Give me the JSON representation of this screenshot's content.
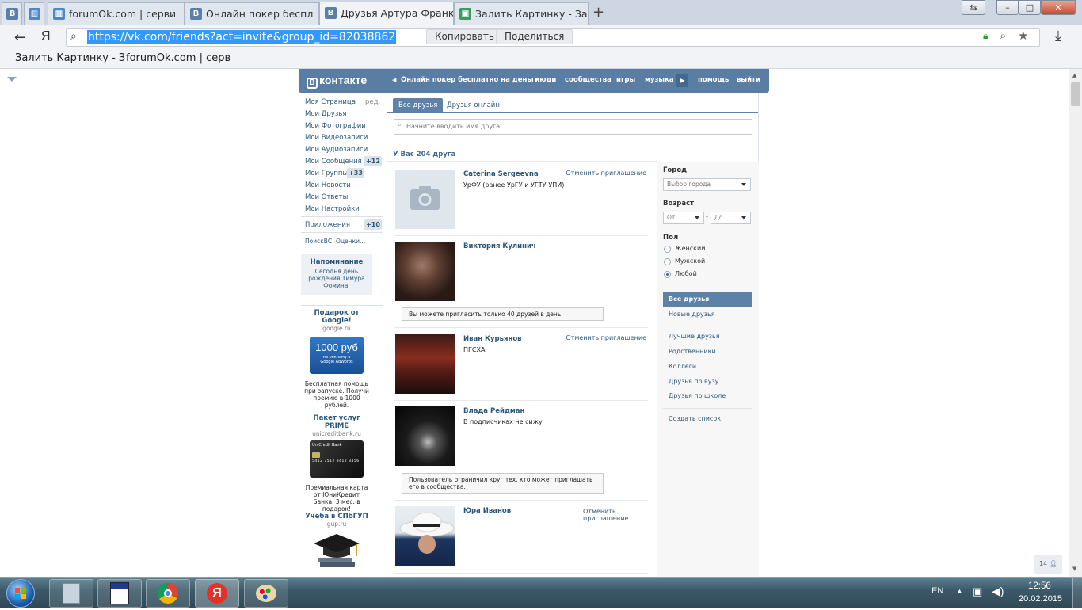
{
  "browser": {
    "tabs": [
      {
        "title": "forumOk.com | серви",
        "icon": "forumok-favicon"
      },
      {
        "title": "Онлайн покер беспл",
        "icon": "vk-favicon"
      },
      {
        "title": "Друзья Артура Франк",
        "icon": "vk-favicon"
      },
      {
        "title": "Залить Картинку - За",
        "icon": "image-favicon"
      }
    ],
    "pinned_icon_1": "В",
    "url": "https://vk.com/friends?act=invite&group_id=82038862",
    "copy_label": "Копировать",
    "share_label": "Поделиться",
    "yandex_letter": "Я",
    "bookmarks": [
      "Залить Картинку - З",
      "forumOk.com | серв"
    ],
    "tab_glyph": "В"
  },
  "vk": {
    "logo": "контакте",
    "logo_letter": "B",
    "nav": {
      "back_title": "Онлайн покер бесплатно на деньги",
      "people": "люди",
      "communities": "сообщества",
      "games": "игры",
      "music": "музыка",
      "help": "помощь",
      "logout": "выйти"
    },
    "left_menu": [
      {
        "label": "Моя Страница",
        "extra": "ред."
      },
      {
        "label": "Мои Друзья"
      },
      {
        "label": "Мои Фотографии"
      },
      {
        "label": "Мои Видеозаписи"
      },
      {
        "label": "Мои Аудиозаписи"
      },
      {
        "label": "Мои Сообщения",
        "count": "+12"
      },
      {
        "label": "Мои Группы",
        "count": "+33"
      },
      {
        "label": "Мои Новости"
      },
      {
        "label": "Мои Ответы"
      },
      {
        "label": "Мои Настройки"
      }
    ],
    "apps": {
      "label": "Приложения",
      "count": "+10"
    },
    "search_app": "ПоискВС: Оценки...",
    "reminder": {
      "title": "Напоминание",
      "text": "Сегодня день рождения Тимура Фомина."
    },
    "ads": [
      {
        "title": "Подарок от Google!",
        "domain": "google.ru",
        "banner_big": "1000 руб",
        "banner_small": "на рекламу в Google AdWords",
        "text": "Бесплатная помощь при запуске. Получи премию в 1000 рублей."
      },
      {
        "title": "Пакет услуг PRIME",
        "domain": "unicreditbank.ru",
        "card_brand": "UniCredit Bank",
        "card_number": "5412 7512 3412 3456",
        "text": "Премиальная карта от ЮниКредит Банка. 3 мес. в подарок!"
      },
      {
        "title": "Учеба в СПбГУП",
        "domain": "gup.ru"
      }
    ],
    "tabs": {
      "all": "Все друзья",
      "online": "Друзья онлайн"
    },
    "search_placeholder": "Начните вводить имя друга",
    "friends_count": "У Вас 204 друга",
    "friends": [
      {
        "name": "Caterina Sergeevna",
        "sub": "УрФУ (ранее УрГУ и УГТУ-УПИ)",
        "action": "Отменить приглашение"
      },
      {
        "name": "Виктория Кулинич",
        "sub": "",
        "action": "",
        "note": "Вы можете пригласить только 40 друзей в день."
      },
      {
        "name": "Иван Курьянов",
        "sub": "ПГСХА",
        "action": "Отменить приглашение"
      },
      {
        "name": "Влада Рейдман",
        "sub": "В подписчиках не сижу",
        "action": "",
        "note": "Пользователь ограничил круг тех, кто может приглашать его в сообщества."
      },
      {
        "name": "Юра Иванов",
        "sub": "",
        "action": "Отменить приглашение"
      }
    ],
    "filters": {
      "city_label": "Город",
      "city_value": "Выбор города",
      "age_label": "Возраст",
      "age_from": "От",
      "age_dash": "-",
      "age_to": "До",
      "sex_label": "Пол",
      "sex_options": [
        "Женский",
        "Мужской",
        "Любой"
      ],
      "sex_selected": "Любой"
    },
    "right_links": {
      "all": "Все друзья",
      "new": "Новые друзья",
      "best": "Лучшие друзья",
      "relatives": "Родственники",
      "colleagues": "Коллеги",
      "uni": "Друзья по вузу",
      "school": "Друзья по школе",
      "create": "Создать список"
    },
    "online_badge": "14"
  },
  "taskbar": {
    "lang": "EN",
    "time": "12:56",
    "date": "20.02.2015"
  },
  "colors": {
    "vk_header": "#597da3",
    "vk_link": "#2b587a",
    "url_highlight": "#3399ff"
  }
}
